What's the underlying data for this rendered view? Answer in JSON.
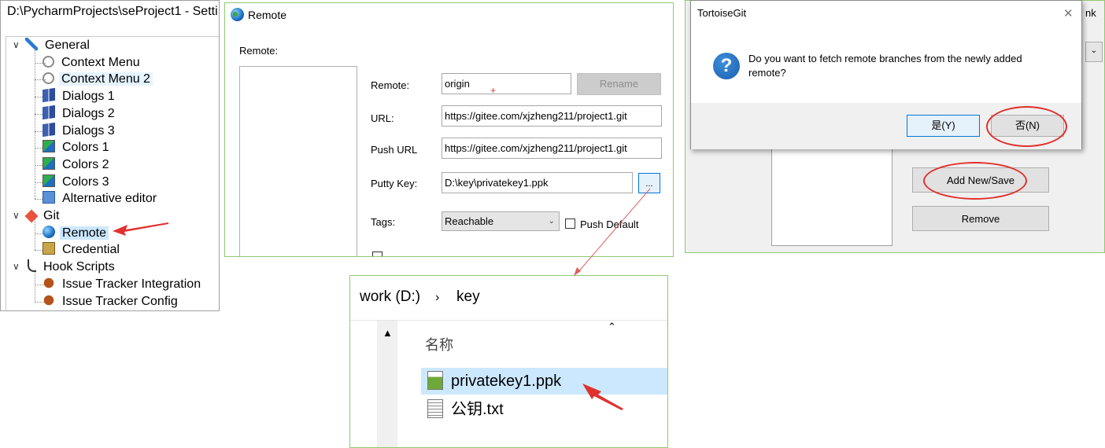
{
  "settings_panel": {
    "window_title": "D:\\PycharmProjects\\seProject1 - Setti",
    "tree": [
      {
        "label": "General",
        "level": 0,
        "icon": "wrench-icon",
        "state": "normal"
      },
      {
        "label": "Context Menu",
        "level": 1,
        "icon": "gear-icon",
        "state": "normal"
      },
      {
        "label": "Context Menu 2",
        "level": 1,
        "icon": "gear-icon",
        "state": "hover"
      },
      {
        "label": "Dialogs 1",
        "level": 1,
        "icon": "windows-icon",
        "state": "normal"
      },
      {
        "label": "Dialogs 2",
        "level": 1,
        "icon": "windows-icon",
        "state": "normal"
      },
      {
        "label": "Dialogs 3",
        "level": 1,
        "icon": "windows-icon",
        "state": "normal"
      },
      {
        "label": "Colors 1",
        "level": 1,
        "icon": "palette-icon",
        "state": "normal"
      },
      {
        "label": "Colors 2",
        "level": 1,
        "icon": "palette-icon",
        "state": "normal"
      },
      {
        "label": "Colors 3",
        "level": 1,
        "icon": "palette-icon",
        "state": "normal"
      },
      {
        "label": "Alternative editor",
        "level": 1,
        "icon": "editor-icon",
        "state": "normal"
      },
      {
        "label": "Git",
        "level": 0,
        "icon": "git-icon",
        "state": "normal"
      },
      {
        "label": "Remote",
        "level": 1,
        "icon": "globe-icon",
        "state": "selected"
      },
      {
        "label": "Credential",
        "level": 1,
        "icon": "credential-icon",
        "state": "normal"
      },
      {
        "label": "Hook Scripts",
        "level": 0,
        "icon": "hook-icon",
        "state": "normal"
      },
      {
        "label": "Issue Tracker Integration",
        "level": 1,
        "icon": "bug-icon",
        "state": "normal"
      },
      {
        "label": "Issue Tracker Config",
        "level": 1,
        "icon": "bug-icon",
        "state": "normal"
      }
    ]
  },
  "remote_panel": {
    "title": "Remote",
    "remote_list_label": "Remote:",
    "remote_label": "Remote:",
    "remote_value": "origin",
    "rename_button": "Rename",
    "url_label": "URL:",
    "url_value": "https://gitee.com/xjzheng211/project1.git",
    "push_url_label": "Push URL",
    "push_url_value": "https://gitee.com/xjzheng211/project1.git",
    "putty_key_label": "Putty Key:",
    "putty_key_value": "D:\\key\\privatekey1.ppk",
    "browse_button": "...",
    "tags_label": "Tags:",
    "tags_value": "Reachable",
    "push_default_label": "Push Default"
  },
  "tortoise_dialog": {
    "title": "TortoiseGit",
    "close_glyph": "✕",
    "message": "Do you want to fetch remote branches from the newly added remote?",
    "yes_button": "是(Y)",
    "no_button": "否(N)",
    "bg_partial_text": "nk",
    "add_new_save_button": "Add New/Save",
    "remove_button": "Remove"
  },
  "explorer": {
    "breadcrumb": [
      "work (D:)",
      "key"
    ],
    "column_header": "名称",
    "files": [
      {
        "name": "privatekey1.ppk",
        "icon": "ppk-file-icon",
        "selected": true
      },
      {
        "name": "公钥.txt",
        "icon": "text-file-icon",
        "selected": false
      }
    ]
  },
  "colors": {
    "selection": "#cce8ff",
    "annotation_red": "#e0312f",
    "panel_border": "#8fc970"
  }
}
